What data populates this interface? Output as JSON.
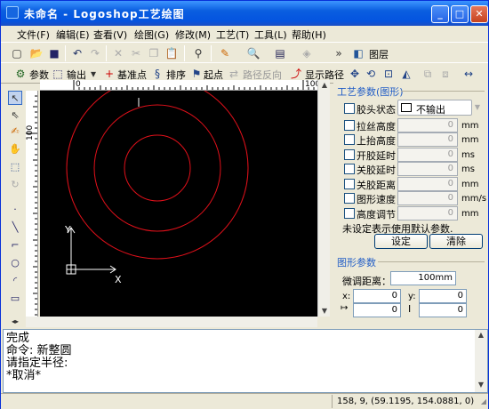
{
  "window": {
    "title": "未命名 - Logoshop工艺绘图",
    "min_label": "_",
    "max_label": "□",
    "close_label": "✕"
  },
  "menu": {
    "items": [
      "文件(F)",
      "编辑(E)",
      "查看(V)",
      "绘图(G)",
      "修改(M)",
      "工艺(T)",
      "工具(L)",
      "帮助(H)"
    ]
  },
  "toolbar1": {
    "layers_label": "图层"
  },
  "toolbar2": {
    "params_label": "参数",
    "output_label": "输出",
    "basepoint_label": "基准点",
    "sort_label": "排序",
    "startpoint_label": "起点",
    "reverse_label": "路径反向",
    "showpath_label": "显示路径"
  },
  "ruler": {
    "h_labels": [
      "0",
      "100"
    ],
    "v_labels": [
      "100"
    ]
  },
  "canvas": {
    "axis_y": "Y",
    "axis_x": "X"
  },
  "process_panel": {
    "title": "工艺参数(图形)",
    "nozzle_label": "胶头状态",
    "nozzle_value": "不输出",
    "params": [
      {
        "label": "拉丝高度",
        "value": "0",
        "unit": "mm"
      },
      {
        "label": "上抬高度",
        "value": "0",
        "unit": "mm"
      },
      {
        "label": "开胶延时",
        "value": "0",
        "unit": "ms"
      },
      {
        "label": "关胶延时",
        "value": "0",
        "unit": "ms"
      },
      {
        "label": "关胶距离",
        "value": "0",
        "unit": "mm"
      },
      {
        "label": "图形速度",
        "value": "0",
        "unit": "mm/s"
      },
      {
        "label": "高度调节",
        "value": "0",
        "unit": "mm"
      }
    ],
    "note": "未设定表示使用默认参数.",
    "set_button": "设定",
    "clear_button": "清除"
  },
  "shape_panel": {
    "title": "图形参数",
    "offset_label": "微调距离：",
    "offset_value": "100mm",
    "x_label": "x:",
    "x_value": "0",
    "y_label": "y:",
    "y_value": "0",
    "w_value": "0",
    "h_value": "0"
  },
  "command": {
    "lines": [
      "完成",
      "命令: 新整圆",
      "请指定半径:",
      "*取消*"
    ]
  },
  "status": {
    "coords": "158, 9, (59.1195, 154.0881, 0)"
  }
}
